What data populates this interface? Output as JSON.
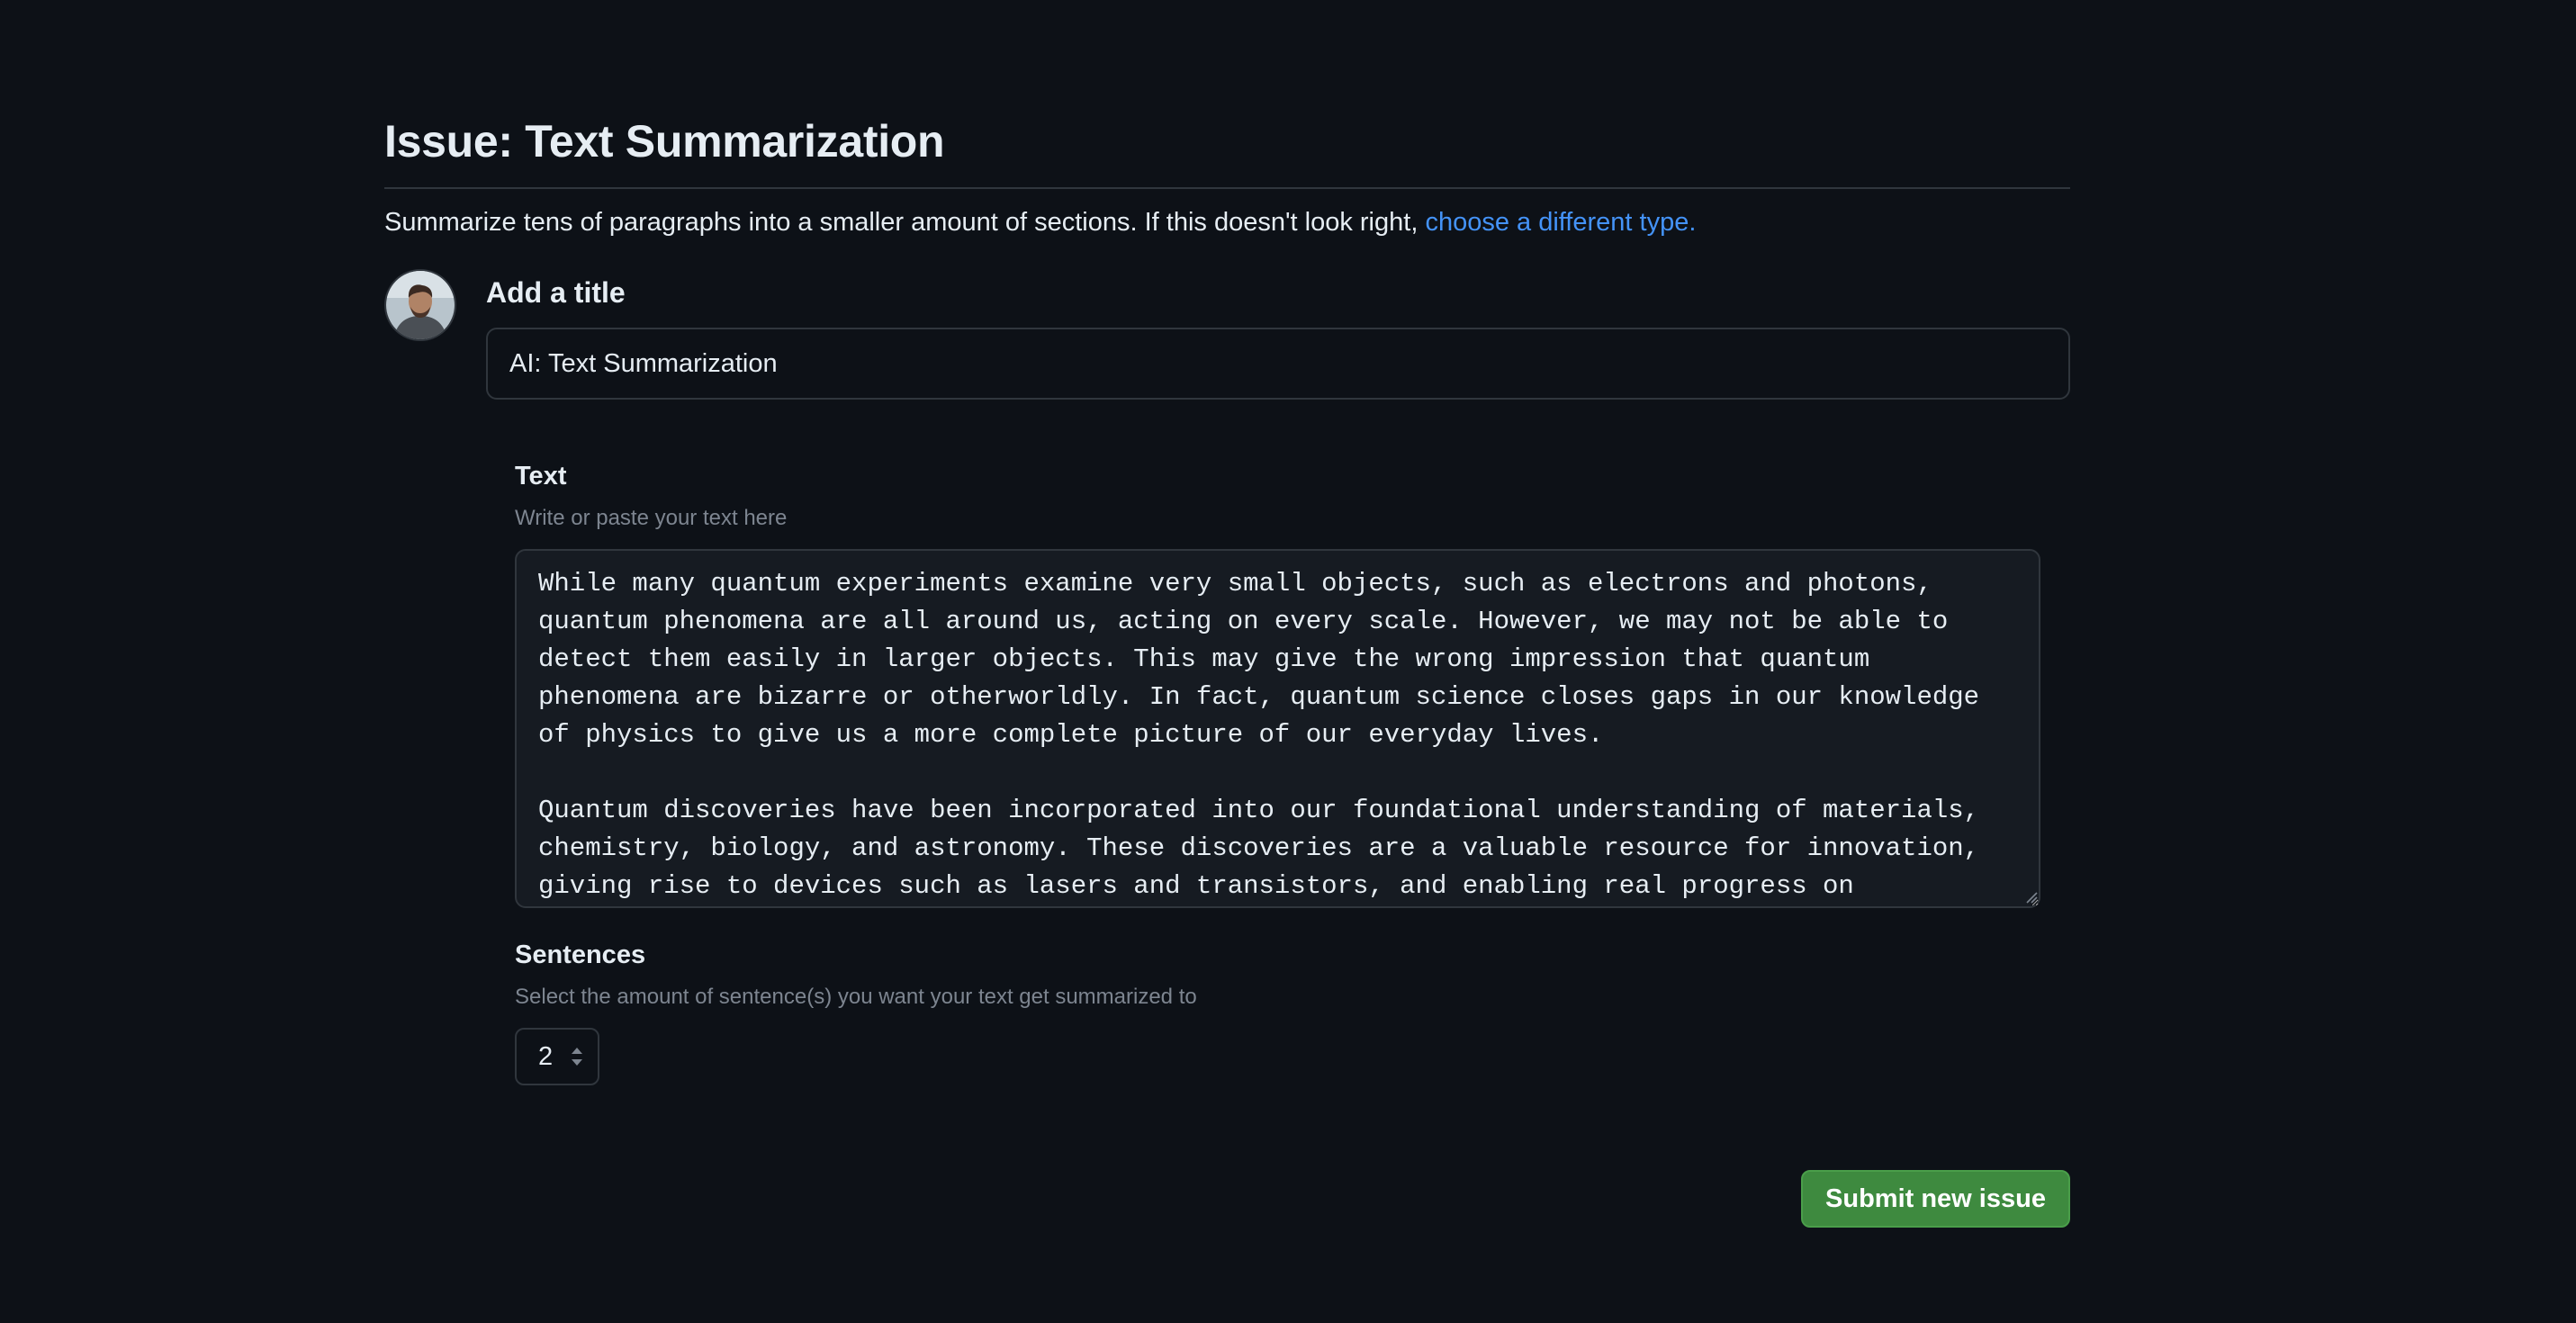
{
  "header": {
    "title": "Issue: Text Summarization",
    "description": "Summarize tens of paragraphs into a smaller amount of sections. If this doesn't look right, ",
    "change_type_link": "choose a different type."
  },
  "title_field": {
    "label": "Add a title",
    "value": "AI: Text Summarization"
  },
  "text_field": {
    "label": "Text",
    "help": "Write or paste your text here",
    "value": "While many quantum experiments examine very small objects, such as electrons and photons, quantum phenomena are all around us, acting on every scale. However, we may not be able to detect them easily in larger objects. This may give the wrong impression that quantum phenomena are bizarre or otherworldly. In fact, quantum science closes gaps in our knowledge of physics to give us a more complete picture of our everyday lives.\n\nQuantum discoveries have been incorporated into our foundational understanding of materials, chemistry, biology, and astronomy. These discoveries are a valuable resource for innovation, giving rise to devices such as lasers and transistors, and enabling real progress on technologies"
  },
  "sentences_field": {
    "label": "Sentences",
    "help": "Select the amount of sentence(s) you want your text get summarized to",
    "value": "2"
  },
  "actions": {
    "submit_label": "Submit new issue"
  },
  "colors": {
    "background": "#0d1117",
    "link": "#4493f8",
    "submit": "#3e8a3f"
  }
}
